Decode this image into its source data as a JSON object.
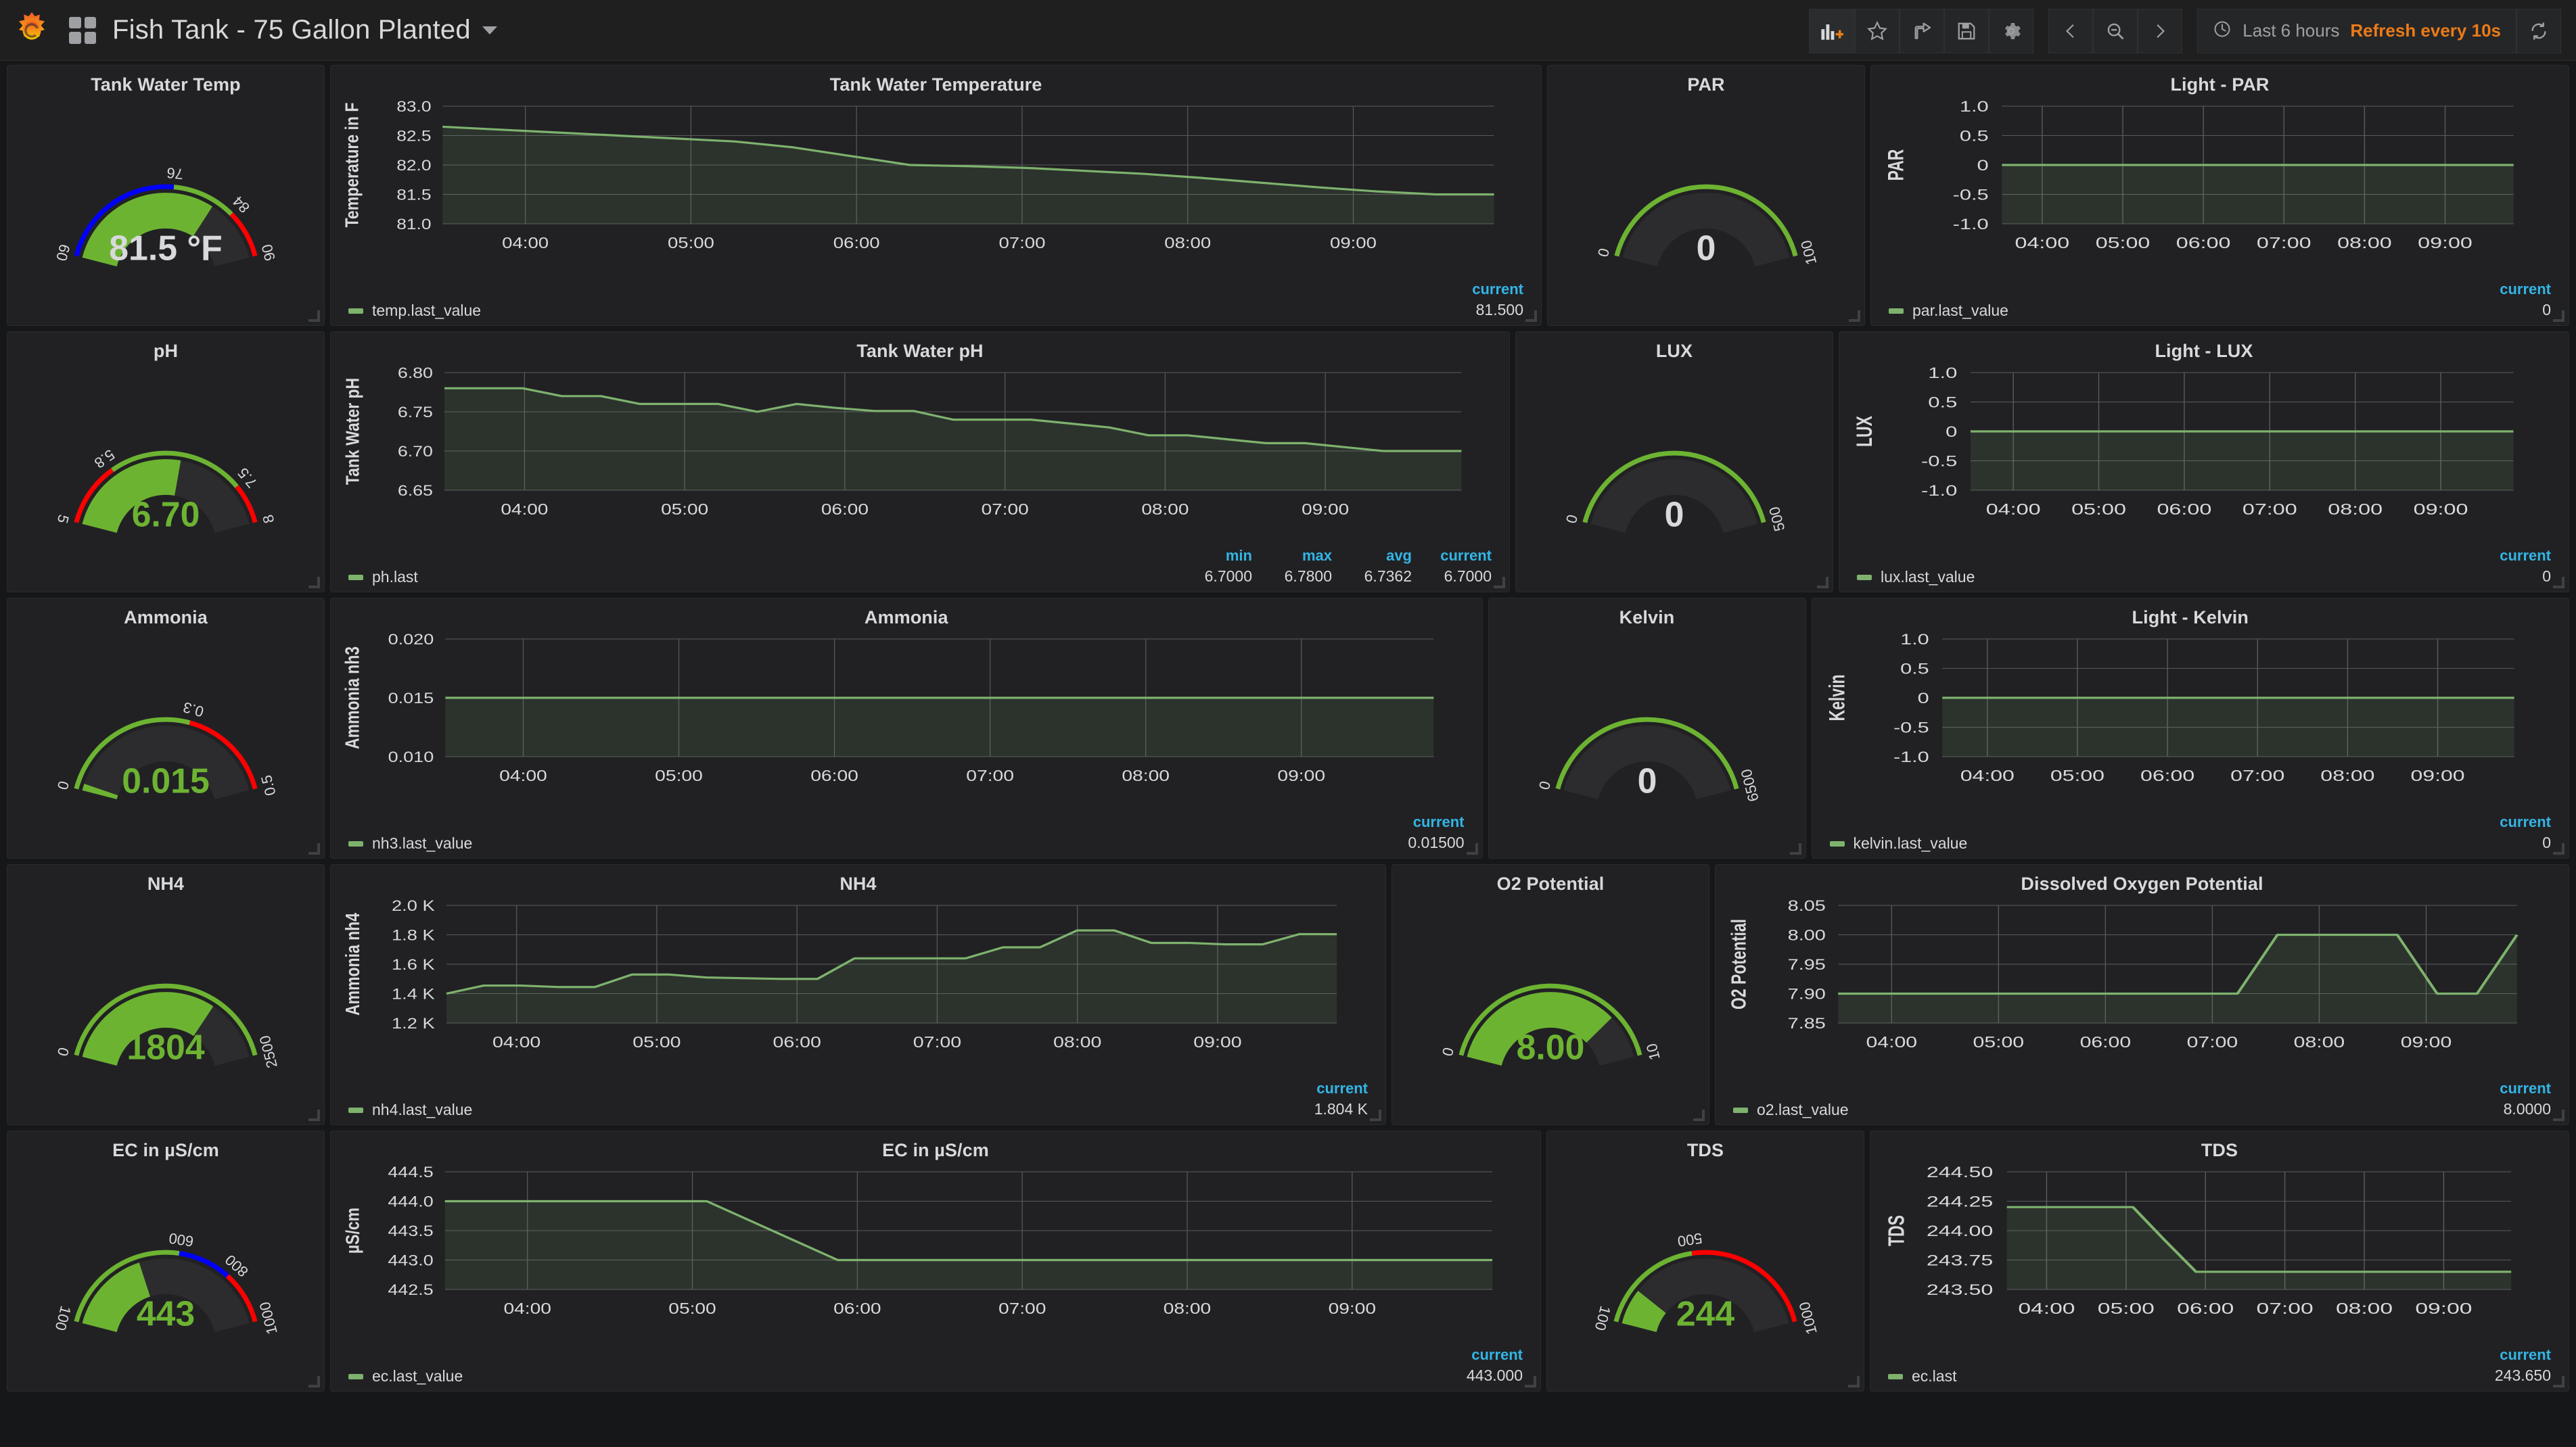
{
  "header": {
    "logo_icon": "grafana-logo",
    "dashboard_icon": "dashboard-grid-icon",
    "title": "Fish Tank - 75 Gallon Planted",
    "title_caret_icon": "chevron-down-icon",
    "buttons": [
      {
        "name": "add-panel-button",
        "icon": "add-panel-icon",
        "label": ""
      },
      {
        "name": "star-dashboard-button",
        "icon": "star-icon",
        "label": ""
      },
      {
        "name": "share-dashboard-button",
        "icon": "share-icon",
        "label": ""
      },
      {
        "name": "save-dashboard-button",
        "icon": "save-icon",
        "label": ""
      },
      {
        "name": "dashboard-settings-button",
        "icon": "gear-icon",
        "label": ""
      }
    ],
    "nav_buttons": [
      {
        "name": "time-back-button",
        "icon": "chevron-left-icon"
      },
      {
        "name": "zoom-out-button",
        "icon": "magnifier-minus-icon"
      },
      {
        "name": "time-forward-button",
        "icon": "chevron-right-icon"
      }
    ],
    "time_picker": {
      "clock_icon": "clock-icon",
      "range": "Last 6 hours",
      "refresh": "Refresh every 10s",
      "refresh_color": "#eb7b18"
    },
    "refresh_button": {
      "name": "refresh-button",
      "icon": "refresh-icon"
    }
  },
  "colors": {
    "green": "#7eb26d",
    "gauge_green": "#6db332",
    "gauge_red": "#ff0000",
    "gauge_blue": "#0000ff",
    "gauge_track": "#2f2f30",
    "value_white": "#d8d9da",
    "legend_blue": "#33b5e5"
  },
  "panels": {
    "temp_gauge": {
      "title": "Tank Water Temp",
      "value_text": "81.5 °F",
      "value_color": "#d8d9da",
      "min_label": "60",
      "max_label": "90",
      "min": 60,
      "max": 90,
      "value": 81.5,
      "threshold_labels": [
        "76",
        "84"
      ],
      "thresholds": [
        {
          "from": 60,
          "to": 76,
          "color": "#0000ff"
        },
        {
          "from": 76,
          "to": 84,
          "color": "#6db332"
        },
        {
          "from": 84,
          "to": 90,
          "color": "#ff0000"
        }
      ]
    },
    "ph_gauge": {
      "title": "pH",
      "value_text": "6.70",
      "value_color": "#6db332",
      "min_label": "5",
      "max_label": "8",
      "min": 5,
      "max": 8,
      "value": 6.7,
      "threshold_labels": [
        "5.8",
        "7.5"
      ],
      "thresholds": [
        {
          "from": 5,
          "to": 5.8,
          "color": "#ff0000"
        },
        {
          "from": 5.8,
          "to": 7.5,
          "color": "#6db332"
        },
        {
          "from": 7.5,
          "to": 8,
          "color": "#ff0000"
        }
      ]
    },
    "ammonia_gauge": {
      "title": "Ammonia",
      "value_text": "0.015",
      "value_color": "#6db332",
      "min_label": "0",
      "max_label": "0.5",
      "min": 0,
      "max": 0.5,
      "value": 0.015,
      "threshold_labels": [
        "0.3"
      ],
      "thresholds": [
        {
          "from": 0,
          "to": 0.3,
          "color": "#6db332"
        },
        {
          "from": 0.3,
          "to": 0.5,
          "color": "#ff0000"
        }
      ]
    },
    "nh4_gauge": {
      "title": "NH4",
      "value_text": "1804",
      "value_color": "#6db332",
      "min_label": "0",
      "max_label": "2500",
      "min": 0,
      "max": 2500,
      "value": 1804,
      "threshold_labels": [],
      "thresholds": [
        {
          "from": 0,
          "to": 2500,
          "color": "#6db332"
        }
      ]
    },
    "ec_gauge": {
      "title": "EC in µS/cm",
      "value_text": "443",
      "value_color": "#6db332",
      "min_label": "100",
      "max_label": "1000",
      "min": 100,
      "max": 1000,
      "value": 443,
      "threshold_labels": [
        "600",
        "800"
      ],
      "thresholds": [
        {
          "from": 100,
          "to": 600,
          "color": "#6db332"
        },
        {
          "from": 600,
          "to": 800,
          "color": "#0000ff"
        },
        {
          "from": 800,
          "to": 1000,
          "color": "#ff0000"
        }
      ]
    },
    "par_gauge": {
      "title": "PAR",
      "value_text": "0",
      "value_color": "#d8d9da",
      "min_label": "0",
      "max_label": "100",
      "min": 0,
      "max": 100,
      "value": 0,
      "threshold_labels": [],
      "thresholds": [
        {
          "from": 0,
          "to": 100,
          "color": "#6db332"
        }
      ]
    },
    "lux_gauge": {
      "title": "LUX",
      "value_text": "0",
      "value_color": "#d8d9da",
      "min_label": "0",
      "max_label": "500",
      "min": 0,
      "max": 500,
      "value": 0,
      "threshold_labels": [],
      "thresholds": [
        {
          "from": 0,
          "to": 500,
          "color": "#6db332"
        }
      ]
    },
    "kelvin_gauge": {
      "title": "Kelvin",
      "value_text": "0",
      "value_color": "#d8d9da",
      "min_label": "0",
      "max_label": "6500",
      "min": 0,
      "max": 6500,
      "value": 0,
      "threshold_labels": [],
      "thresholds": [
        {
          "from": 0,
          "to": 6500,
          "color": "#6db332"
        }
      ]
    },
    "o2_gauge": {
      "title": "O2 Potential",
      "value_text": "8.00",
      "value_color": "#6db332",
      "min_label": "0",
      "max_label": "10",
      "min": 0,
      "max": 10,
      "value": 8,
      "threshold_labels": [],
      "thresholds": [
        {
          "from": 0,
          "to": 10,
          "color": "#6db332"
        }
      ]
    },
    "tds_gauge": {
      "title": "TDS",
      "value_text": "244",
      "value_color": "#6db332",
      "min_label": "100",
      "max_label": "1000",
      "min": 100,
      "max": 1000,
      "value": 244,
      "threshold_labels": [
        "500"
      ],
      "thresholds": [
        {
          "from": 100,
          "to": 500,
          "color": "#6db332"
        },
        {
          "from": 500,
          "to": 1000,
          "color": "#ff0000"
        }
      ]
    }
  },
  "chart_data": [
    {
      "id": "temp_chart",
      "type": "line",
      "title": "Tank Water Temperature",
      "ylabel": "Temperature in F",
      "xlabel": "",
      "ylim": [
        81.0,
        83.0
      ],
      "yticks": [
        "81.0",
        "81.5",
        "82.0",
        "82.5",
        "83.0"
      ],
      "ytick_values": [
        81.0,
        81.5,
        82.0,
        82.5,
        83.0
      ],
      "xticks": [
        "04:00",
        "05:00",
        "06:00",
        "07:00",
        "08:00",
        "09:00"
      ],
      "grid": true,
      "legend_position": "bottom",
      "series": [
        {
          "name": "temp.last_value",
          "color": "#7eb26d",
          "values": [
            82.65,
            82.6,
            82.55,
            82.5,
            82.45,
            82.4,
            82.3,
            82.15,
            82.0,
            81.98,
            81.95,
            81.9,
            81.85,
            81.78,
            81.7,
            81.62,
            81.55,
            81.5,
            81.5
          ]
        }
      ],
      "stats_headers": [
        "current"
      ],
      "stats": [
        {
          "name": "temp.last_value",
          "current": "81.500"
        }
      ]
    },
    {
      "id": "par_chart",
      "type": "line",
      "title": "Light - PAR",
      "ylabel": "PAR",
      "xlabel": "",
      "ylim": [
        -1.0,
        1.0
      ],
      "yticks": [
        "-1.0",
        "-0.5",
        "0",
        "0.5",
        "1.0"
      ],
      "ytick_values": [
        -1.0,
        -0.5,
        0,
        0.5,
        1.0
      ],
      "xticks": [
        "04:00",
        "05:00",
        "06:00",
        "07:00",
        "08:00",
        "09:00"
      ],
      "grid": true,
      "legend_position": "bottom",
      "series": [
        {
          "name": "par.last_value",
          "color": "#7eb26d",
          "values": [
            0,
            0,
            0,
            0,
            0,
            0,
            0,
            0,
            0,
            0,
            0,
            0,
            0,
            0,
            0,
            0,
            0,
            0,
            0
          ]
        }
      ],
      "stats_headers": [
        "current"
      ],
      "stats": [
        {
          "name": "par.last_value",
          "current": "0"
        }
      ]
    },
    {
      "id": "ph_chart",
      "type": "line",
      "title": "Tank Water pH",
      "ylabel": "Tank Water pH",
      "xlabel": "",
      "ylim": [
        6.65,
        6.8
      ],
      "yticks": [
        "6.65",
        "6.70",
        "6.75",
        "6.80"
      ],
      "ytick_values": [
        6.65,
        6.7,
        6.75,
        6.8
      ],
      "xticks": [
        "04:00",
        "05:00",
        "06:00",
        "07:00",
        "08:00",
        "09:00"
      ],
      "grid": true,
      "legend_position": "bottom",
      "series": [
        {
          "name": "ph.last",
          "color": "#7eb26d",
          "values": [
            6.78,
            6.78,
            6.78,
            6.77,
            6.77,
            6.76,
            6.76,
            6.76,
            6.75,
            6.76,
            6.755,
            6.751,
            6.751,
            6.74,
            6.74,
            6.74,
            6.735,
            6.73,
            6.72,
            6.72,
            6.715,
            6.71,
            6.71,
            6.705,
            6.7,
            6.7,
            6.7
          ]
        }
      ],
      "stats_headers": [
        "min",
        "max",
        "avg",
        "current"
      ],
      "stats": [
        {
          "name": "ph.last",
          "min": "6.7000",
          "max": "6.7800",
          "avg": "6.7362",
          "current": "6.7000"
        }
      ]
    },
    {
      "id": "lux_chart",
      "type": "line",
      "title": "Light - LUX",
      "ylabel": "LUX",
      "xlabel": "",
      "ylim": [
        -1.0,
        1.0
      ],
      "yticks": [
        "-1.0",
        "-0.5",
        "0",
        "0.5",
        "1.0"
      ],
      "ytick_values": [
        -1.0,
        -0.5,
        0,
        0.5,
        1.0
      ],
      "xticks": [
        "04:00",
        "05:00",
        "06:00",
        "07:00",
        "08:00",
        "09:00"
      ],
      "grid": true,
      "legend_position": "bottom",
      "series": [
        {
          "name": "lux.last_value",
          "color": "#7eb26d",
          "values": [
            0,
            0,
            0,
            0,
            0,
            0,
            0,
            0,
            0,
            0,
            0,
            0,
            0,
            0,
            0,
            0,
            0,
            0,
            0
          ]
        }
      ],
      "stats_headers": [
        "current"
      ],
      "stats": [
        {
          "name": "lux.last_value",
          "current": "0"
        }
      ]
    },
    {
      "id": "ammonia_chart",
      "type": "line",
      "title": "Ammonia",
      "ylabel": "Ammonia nh3",
      "xlabel": "",
      "ylim": [
        0.01,
        0.02
      ],
      "yticks": [
        "0.010",
        "0.015",
        "0.020"
      ],
      "ytick_values": [
        0.01,
        0.015,
        0.02
      ],
      "xticks": [
        "04:00",
        "05:00",
        "06:00",
        "07:00",
        "08:00",
        "09:00"
      ],
      "grid": true,
      "legend_position": "bottom",
      "series": [
        {
          "name": "nh3.last_value",
          "color": "#7eb26d",
          "values": [
            0.015,
            0.015,
            0.015,
            0.015,
            0.015,
            0.015,
            0.015,
            0.015,
            0.015,
            0.015,
            0.015,
            0.015,
            0.015,
            0.015,
            0.015,
            0.015,
            0.015
          ]
        }
      ],
      "stats_headers": [
        "current"
      ],
      "stats": [
        {
          "name": "nh3.last_value",
          "current": "0.01500"
        }
      ]
    },
    {
      "id": "kelvin_chart",
      "type": "line",
      "title": "Light - Kelvin",
      "ylabel": "Kelvin",
      "xlabel": "",
      "ylim": [
        -1.0,
        1.0
      ],
      "yticks": [
        "-1.0",
        "-0.5",
        "0",
        "0.5",
        "1.0"
      ],
      "ytick_values": [
        -1.0,
        -0.5,
        0,
        0.5,
        1.0
      ],
      "xticks": [
        "04:00",
        "05:00",
        "06:00",
        "07:00",
        "08:00",
        "09:00"
      ],
      "grid": true,
      "legend_position": "bottom",
      "series": [
        {
          "name": "kelvin.last_value",
          "color": "#7eb26d",
          "values": [
            0,
            0,
            0,
            0,
            0,
            0,
            0,
            0,
            0,
            0,
            0,
            0,
            0,
            0,
            0,
            0,
            0,
            0,
            0
          ]
        }
      ],
      "stats_headers": [
        "current"
      ],
      "stats": [
        {
          "name": "kelvin.last_value",
          "current": "0"
        }
      ]
    },
    {
      "id": "nh4_chart",
      "type": "line",
      "title": "NH4",
      "ylabel": "Ammonia nh4",
      "xlabel": "",
      "ylim": [
        1200,
        2000
      ],
      "yticks": [
        "1.2 K",
        "1.4 K",
        "1.6 K",
        "1.8 K",
        "2.0 K"
      ],
      "ytick_values": [
        1200,
        1400,
        1600,
        1800,
        2000
      ],
      "xticks": [
        "04:00",
        "05:00",
        "06:00",
        "07:00",
        "08:00",
        "09:00"
      ],
      "grid": true,
      "legend_position": "bottom",
      "series": [
        {
          "name": "nh4.last_value",
          "color": "#7eb26d",
          "values": [
            1400,
            1455,
            1455,
            1445,
            1445,
            1530,
            1530,
            1510,
            1505,
            1500,
            1500,
            1640,
            1640,
            1640,
            1640,
            1715,
            1715,
            1830,
            1830,
            1745,
            1745,
            1735,
            1735,
            1805,
            1804
          ]
        }
      ],
      "stats_headers": [
        "current"
      ],
      "stats": [
        {
          "name": "nh4.last_value",
          "current": "1.804 K"
        }
      ]
    },
    {
      "id": "o2_chart",
      "type": "line",
      "title": "Dissolved Oxygen Potential",
      "ylabel": "O2 Potential",
      "xlabel": "",
      "ylim": [
        7.85,
        8.05
      ],
      "yticks": [
        "7.85",
        "7.90",
        "7.95",
        "8.00",
        "8.05"
      ],
      "ytick_values": [
        7.85,
        7.9,
        7.95,
        8.0,
        8.05
      ],
      "xticks": [
        "04:00",
        "05:00",
        "06:00",
        "07:00",
        "08:00",
        "09:00"
      ],
      "grid": true,
      "legend_position": "bottom",
      "series": [
        {
          "name": "o2.last_value",
          "color": "#7eb26d",
          "values": [
            7.9,
            7.9,
            7.9,
            7.9,
            7.9,
            7.9,
            7.9,
            7.9,
            7.9,
            7.9,
            7.9,
            8.0,
            8.0,
            8.0,
            8.0,
            7.9,
            7.9,
            8.0
          ]
        }
      ],
      "stats_headers": [
        "current"
      ],
      "stats": [
        {
          "name": "o2.last_value",
          "current": "8.0000"
        }
      ]
    },
    {
      "id": "ec_chart",
      "type": "line",
      "title": "EC in µS/cm",
      "ylabel": "µS/cm",
      "xlabel": "",
      "ylim": [
        442.5,
        444.5
      ],
      "yticks": [
        "442.5",
        "443.0",
        "443.5",
        "444.0",
        "444.5"
      ],
      "ytick_values": [
        442.5,
        443.0,
        443.5,
        444.0,
        444.5
      ],
      "xticks": [
        "04:00",
        "05:00",
        "06:00",
        "07:00",
        "08:00",
        "09:00"
      ],
      "grid": true,
      "legend_position": "bottom",
      "series": [
        {
          "name": "ec.last_value",
          "color": "#7eb26d",
          "values": [
            444.0,
            444.0,
            444.0,
            444.0,
            444.0,
            443.5,
            443.0,
            443.0,
            443.0,
            443.0,
            443.0,
            443.0,
            443.0,
            443.0,
            443.0,
            443.0,
            443.0
          ]
        }
      ],
      "stats_headers": [
        "current"
      ],
      "stats": [
        {
          "name": "ec.last_value",
          "current": "443.000"
        }
      ]
    },
    {
      "id": "tds_chart",
      "type": "line",
      "title": "TDS",
      "ylabel": "TDS",
      "xlabel": "",
      "ylim": [
        243.5,
        244.5
      ],
      "yticks": [
        "243.50",
        "243.75",
        "244.00",
        "244.25",
        "244.50"
      ],
      "ytick_values": [
        243.5,
        243.75,
        244.0,
        244.25,
        244.5
      ],
      "xticks": [
        "04:00",
        "05:00",
        "06:00",
        "07:00",
        "08:00",
        "09:00"
      ],
      "grid": true,
      "legend_position": "bottom",
      "series": [
        {
          "name": "ec.last",
          "color": "#7eb26d",
          "values": [
            244.2,
            244.2,
            244.2,
            244.2,
            244.2,
            243.92,
            243.65,
            243.65,
            243.65,
            243.65,
            243.65,
            243.65,
            243.65,
            243.65,
            243.65,
            243.65,
            243.65
          ]
        }
      ],
      "stats_headers": [
        "current"
      ],
      "stats": [
        {
          "name": "ec.last",
          "current": "243.650"
        }
      ]
    }
  ]
}
